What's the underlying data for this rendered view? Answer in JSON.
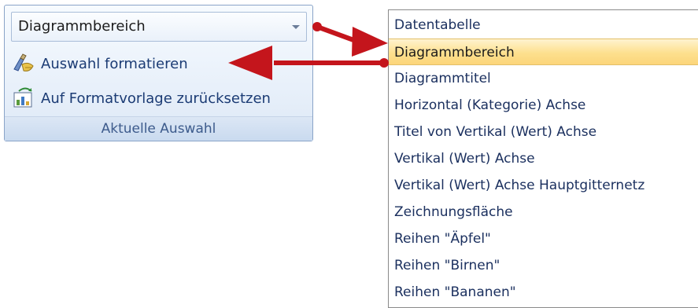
{
  "ribbon": {
    "combo_value": "Diagrammbereich",
    "commands": [
      {
        "label": "Auswahl formatieren",
        "icon": "format-selection-icon"
      },
      {
        "label": "Auf Formatvorlage zurücksetzen",
        "icon": "reset-style-icon"
      }
    ],
    "group_label": "Aktuelle Auswahl"
  },
  "dropdown": {
    "selected_index": 1,
    "items": [
      "Datentabelle",
      "Diagrammbereich",
      "Diagrammtitel",
      "Horizontal (Kategorie) Achse",
      "Titel von Vertikal (Wert) Achse",
      "Vertikal (Wert) Achse",
      "Vertikal (Wert) Achse Hauptgitternetz",
      "Zeichnungsfläche",
      "Reihen \"Äpfel\"",
      "Reihen \"Birnen\"",
      "Reihen \"Bananen\""
    ]
  },
  "colors": {
    "annotation_arrow": "#c4151c",
    "selection_highlight": "#fde08e",
    "text_blue": "#1a2f5e"
  }
}
